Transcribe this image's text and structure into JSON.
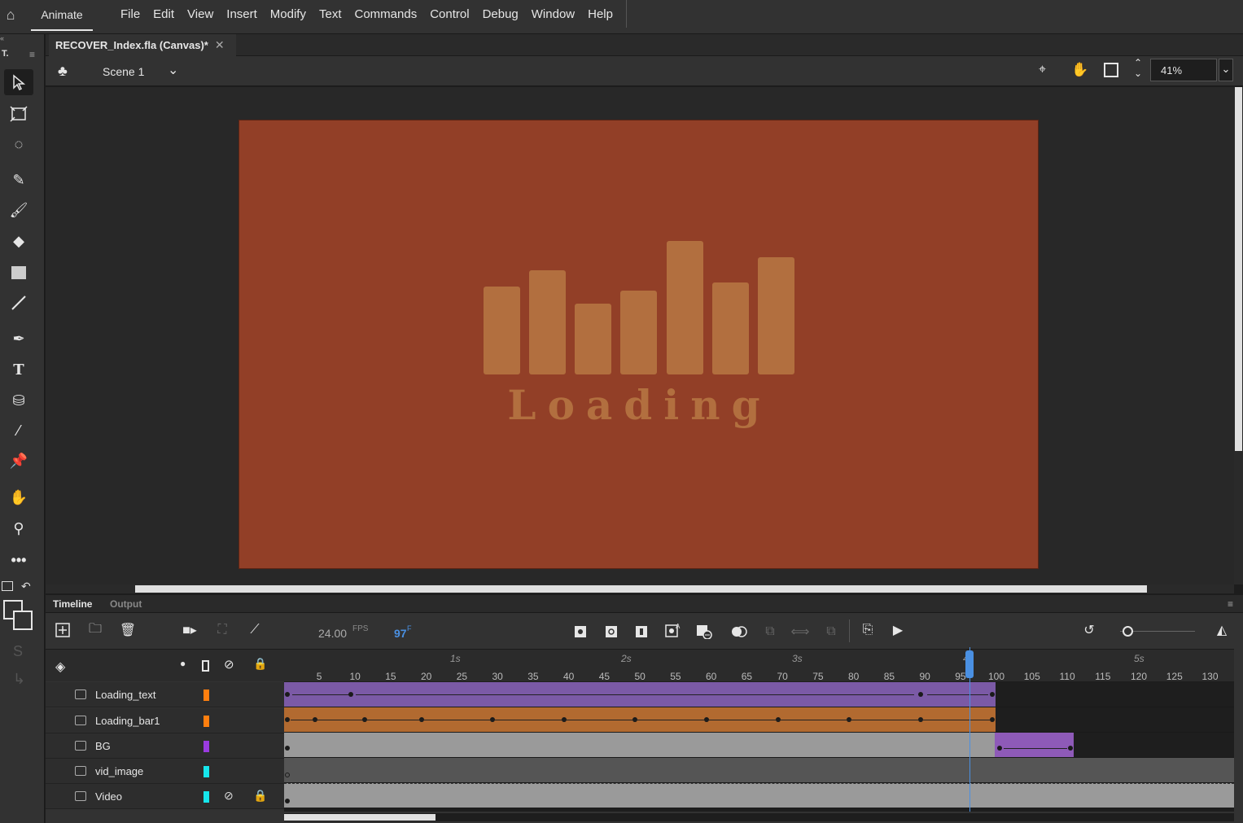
{
  "menubar": {
    "app_name": "Animate",
    "menus": [
      "File",
      "Edit",
      "View",
      "Insert",
      "Modify",
      "Text",
      "Commands",
      "Control",
      "Debug",
      "Window",
      "Help"
    ]
  },
  "toolbox": {
    "header": "T.",
    "tools": [
      "selection-tool",
      "free-transform-tool",
      "lasso-tool",
      "paint-brush-tool",
      "brush-tool",
      "eraser-tool",
      "rectangle-tool",
      "line-tool",
      "pen-tool",
      "text-tool",
      "paint-bucket-tool",
      "eyedropper-tool",
      "bone-tool",
      "hand-tool",
      "zoom-tool",
      "more-tools"
    ]
  },
  "document": {
    "tab_title": "RECOVER_Index.fla (Canvas)*"
  },
  "stage_header": {
    "scene": "Scene 1",
    "zoom": "41%"
  },
  "stage": {
    "canvas_color": "#923f27",
    "art_color": "#b26f3f",
    "loading_text": "Loading"
  },
  "timeline": {
    "tabs": [
      "Timeline",
      "Output"
    ],
    "fps": "24.00",
    "fps_label": "FPS",
    "current_frame": "97",
    "frame_suffix": "F",
    "ruler_ticks": [
      "5",
      "10",
      "15",
      "20",
      "25",
      "30",
      "35",
      "40",
      "45",
      "50",
      "55",
      "60",
      "65",
      "70",
      "75",
      "80",
      "85",
      "90",
      "95",
      "100",
      "105",
      "110",
      "115",
      "120",
      "125",
      "130"
    ],
    "seconds": [
      "1s",
      "2s",
      "3s",
      "4s",
      "5s"
    ],
    "layers": [
      {
        "name": "Loading_text",
        "color": "#ff7f0f"
      },
      {
        "name": "Loading_bar1",
        "color": "#ff7f0f"
      },
      {
        "name": "BG",
        "color": "#9a3be0"
      },
      {
        "name": "vid_image",
        "color": "#16e6ec"
      },
      {
        "name": "Video",
        "color": "#16e6ec"
      }
    ]
  }
}
